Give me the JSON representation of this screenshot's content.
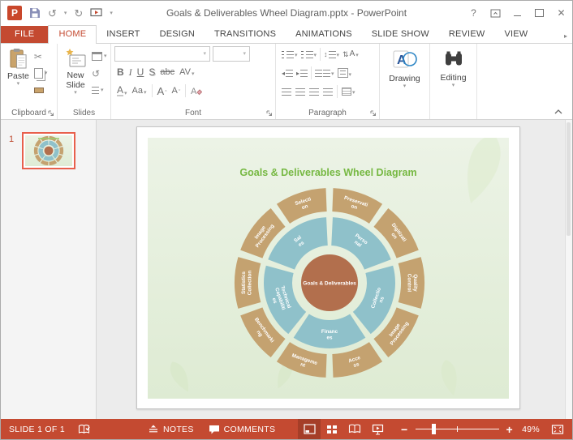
{
  "titlebar": {
    "title": "Goals & Deliverables Wheel Diagram.pptx - PowerPoint",
    "logo_letter": "P",
    "help": "?",
    "close": "✕"
  },
  "tabs": {
    "file": "FILE",
    "items": [
      "HOME",
      "INSERT",
      "DESIGN",
      "TRANSITIONS",
      "ANIMATIONS",
      "SLIDE SHOW",
      "REVIEW",
      "VIEW"
    ],
    "active": "HOME"
  },
  "ribbon": {
    "clipboard": {
      "label": "Clipboard",
      "paste": "Paste"
    },
    "slides": {
      "label": "Slides",
      "new_slide": "New Slide"
    },
    "font": {
      "label": "Font",
      "bold": "B",
      "italic": "I",
      "underline": "U",
      "shadow": "S",
      "strikethrough": "abc",
      "spacing": "AV",
      "color": "A",
      "case": "Aa",
      "grow": "A",
      "shrink": "A"
    },
    "paragraph": {
      "label": "Paragraph"
    },
    "drawing": {
      "label": "Drawing"
    },
    "editing": {
      "label": "Editing"
    }
  },
  "slide_panel": {
    "slide_number": "1"
  },
  "slide": {
    "title": "Goals & Deliverables Wheel Diagram"
  },
  "wheel": {
    "center": {
      "label": "Goals & Deliverables",
      "color": "#B26F4D"
    },
    "middle_ring": {
      "color": "#8FC1CA",
      "segments": [
        {
          "label": "Personal",
          "lines": [
            "Perso",
            "nal"
          ],
          "mid": 36
        },
        {
          "label": "Collections",
          "lines": [
            "Collectio",
            "ns"
          ],
          "mid": 108
        },
        {
          "label": "Finances",
          "lines": [
            "Financ",
            "es"
          ],
          "mid": 180
        },
        {
          "label": "Technical Capabilities",
          "lines": [
            "Technical",
            "Capabiliti",
            "es"
          ],
          "mid": 252
        },
        {
          "label": "Sales",
          "lines": [
            "Sal",
            "es"
          ],
          "mid": 324
        }
      ]
    },
    "outer_ring": {
      "color": "#C4A270",
      "segments": [
        {
          "label": "Preservation",
          "lines": [
            "Preservati",
            "on"
          ],
          "mid": 18
        },
        {
          "label": "Digitization",
          "lines": [
            "Digitizati",
            "on"
          ],
          "mid": 54
        },
        {
          "label": "Quality Control",
          "lines": [
            "Quality",
            "Control"
          ],
          "mid": 90
        },
        {
          "label": "Image Processing",
          "lines": [
            "Image",
            "Processing"
          ],
          "mid": 126
        },
        {
          "label": "Access",
          "lines": [
            "Acce",
            "ss"
          ],
          "mid": 162
        },
        {
          "label": "Management",
          "lines": [
            "Manageme",
            "nt"
          ],
          "mid": 198
        },
        {
          "label": "Benchmarking",
          "lines": [
            "Benchmarki",
            "ng"
          ],
          "mid": 234
        },
        {
          "label": "Statistics Collection",
          "lines": [
            "Statistics",
            "Collection"
          ],
          "mid": 270
        },
        {
          "label": "Image Processing",
          "lines": [
            "Image",
            "Processing"
          ],
          "mid": 306
        },
        {
          "label": "Selection",
          "lines": [
            "Selecti",
            "on"
          ],
          "mid": 342
        }
      ]
    }
  },
  "status": {
    "slide_indicator": "SLIDE 1 OF 1",
    "notes": "NOTES",
    "comments": "COMMENTS",
    "zoom_out": "−",
    "zoom_in": "+",
    "zoom_level": "49%"
  },
  "colors": {
    "accent_red": "#C44A31",
    "selection_orange": "#E8604C",
    "slide_title_green": "#76B842",
    "outer_ring": "#C4A270",
    "middle_ring": "#8FC1CA",
    "center_circle": "#B26F4D"
  }
}
